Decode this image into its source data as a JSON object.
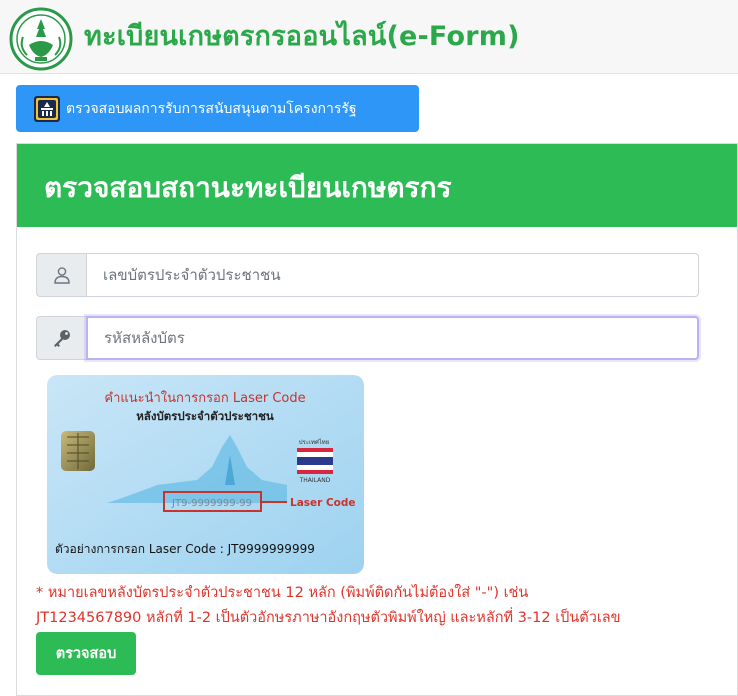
{
  "header": {
    "site_title": "ทะเบียนเกษตรกรออนไลน์(e-Form)"
  },
  "toolbar": {
    "check_support_label": "ตรวจสอบผลการรับการสนับสนุนตามโครงการรัฐ"
  },
  "card": {
    "title": "ตรวจสอบสถานะทะเบียนเกษตรกร",
    "id_field": {
      "placeholder": "เลขบัตรประจำตัวประชาชน",
      "value": ""
    },
    "laser_field": {
      "placeholder": "รหัสหลังบัตร",
      "value": ""
    },
    "laser_card_image": {
      "heading1": "คำแนะนำในการกรอก Laser Code",
      "heading2": "หลังบัตรประจำตัวประชาชน",
      "country_label": "ประเทศไทย",
      "thailand_label": "THAILAND",
      "sample_code": "JT9-9999999-99",
      "laser_code_label": "Laser Code",
      "example_text": "ตัวอย่างการกรอก Laser Code : JT9999999999"
    },
    "note_line1": "* หมายเลขหลังบัตรประจำตัวประชาชน 12 หลัก (พิมพ์ติดกันไม่ต้องใส่ \"-\") เช่น",
    "note_line2": "JT1234567890 หลักที่ 1-2 เป็นตัวอักษรภาษาอังกฤษตัวพิมพ์ใหญ่ และหลักที่ 3-12 เป็นตัวเลข",
    "submit_label": "ตรวจสอบ"
  },
  "colors": {
    "brand_green": "#2dbb55",
    "button_blue": "#2d96f6",
    "note_red": "#e0342b"
  }
}
